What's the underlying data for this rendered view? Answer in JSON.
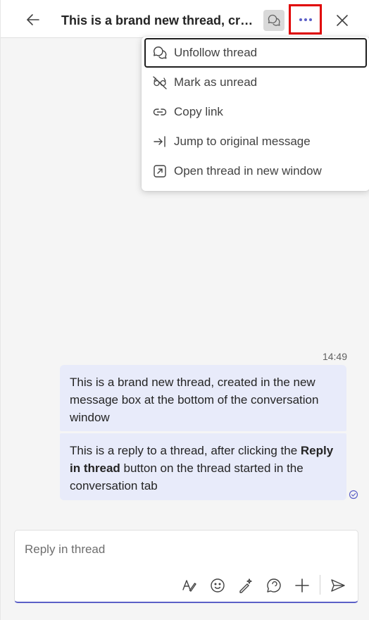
{
  "header": {
    "title": "This is a brand new thread, created in the new message box at the bottom of the conversation window",
    "back_icon": "arrow-left-icon",
    "follow_icon": "chat-bubbles-icon",
    "more_icon": "more-horizontal-icon",
    "close_icon": "close-icon"
  },
  "menu": {
    "items": [
      {
        "label": "Unfollow thread",
        "icon": "chat-bubbles-icon"
      },
      {
        "label": "Mark as unread",
        "icon": "eye-off-icon"
      },
      {
        "label": "Copy link",
        "icon": "link-icon"
      },
      {
        "label": "Jump to original message",
        "icon": "arrow-enter-icon"
      },
      {
        "label": "Open thread in new window",
        "icon": "open-external-icon"
      }
    ]
  },
  "messages": {
    "timestamp": "14:49",
    "items": [
      {
        "text": "This is a brand new thread, created in the new message box at the bottom of the conversation window"
      },
      {
        "text_before": "This is a reply to a thread, after clicking the ",
        "bold": "Reply in thread",
        "text_after": " button on the thread started in the conversation tab"
      }
    ]
  },
  "compose": {
    "placeholder": "Reply in thread",
    "tools": [
      "format-icon",
      "emoji-icon",
      "sparkle-pen-icon",
      "loop-icon",
      "plus-icon",
      "send-icon"
    ]
  },
  "colors": {
    "accent": "#5b5fc7",
    "bubble": "#e8ebfa",
    "highlight": "#e00000",
    "background": "#f5f5f5"
  }
}
